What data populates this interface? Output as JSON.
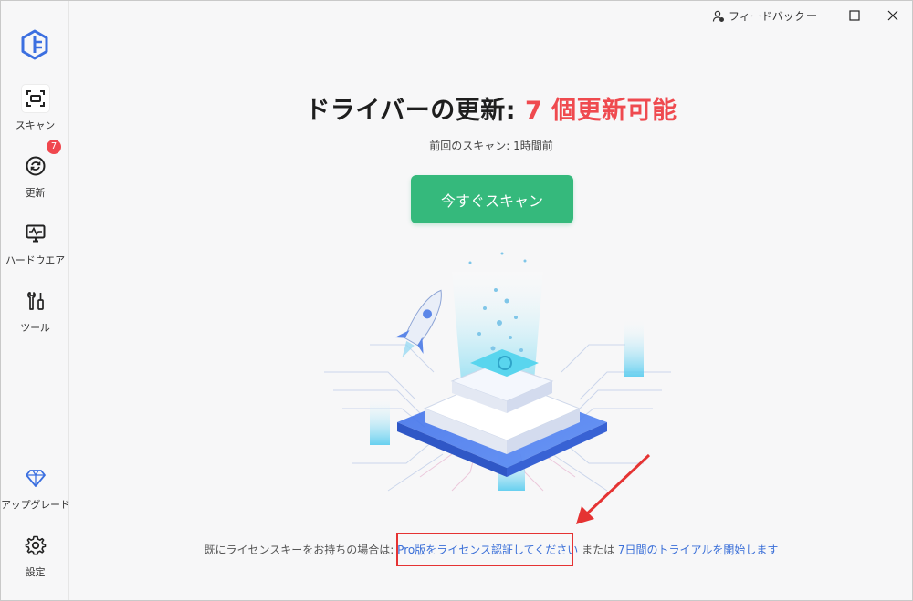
{
  "sidebar": {
    "items": [
      {
        "label": "スキャン",
        "icon": "scan-icon"
      },
      {
        "label": "更新",
        "icon": "refresh-icon",
        "badge": "7"
      },
      {
        "label": "ハードウエア",
        "icon": "hardware-monitor-icon"
      },
      {
        "label": "ツール",
        "icon": "tools-icon"
      },
      {
        "label": "アップグレード",
        "icon": "diamond-icon"
      },
      {
        "label": "設定",
        "icon": "gear-icon"
      }
    ]
  },
  "titlebar": {
    "feedback_label": "フィードバック"
  },
  "main": {
    "headline_prefix": "ドライバーの更新: ",
    "headline_count": "7 個更新可能",
    "last_scan": "前回のスキャン: 1時間前",
    "scan_button": "今すぐスキャン",
    "footer_text": "既にライセンスキーをお持ちの場合は: ",
    "footer_link_pro": "Pro版をライセンス認証してください",
    "footer_or": " または ",
    "footer_link_trial": "7日間のトライアルを開始します"
  },
  "colors": {
    "accent_green": "#35b97c",
    "alert_red": "#ef4a4f",
    "link_blue": "#3a6fd8",
    "annotation_red": "#e53333"
  }
}
